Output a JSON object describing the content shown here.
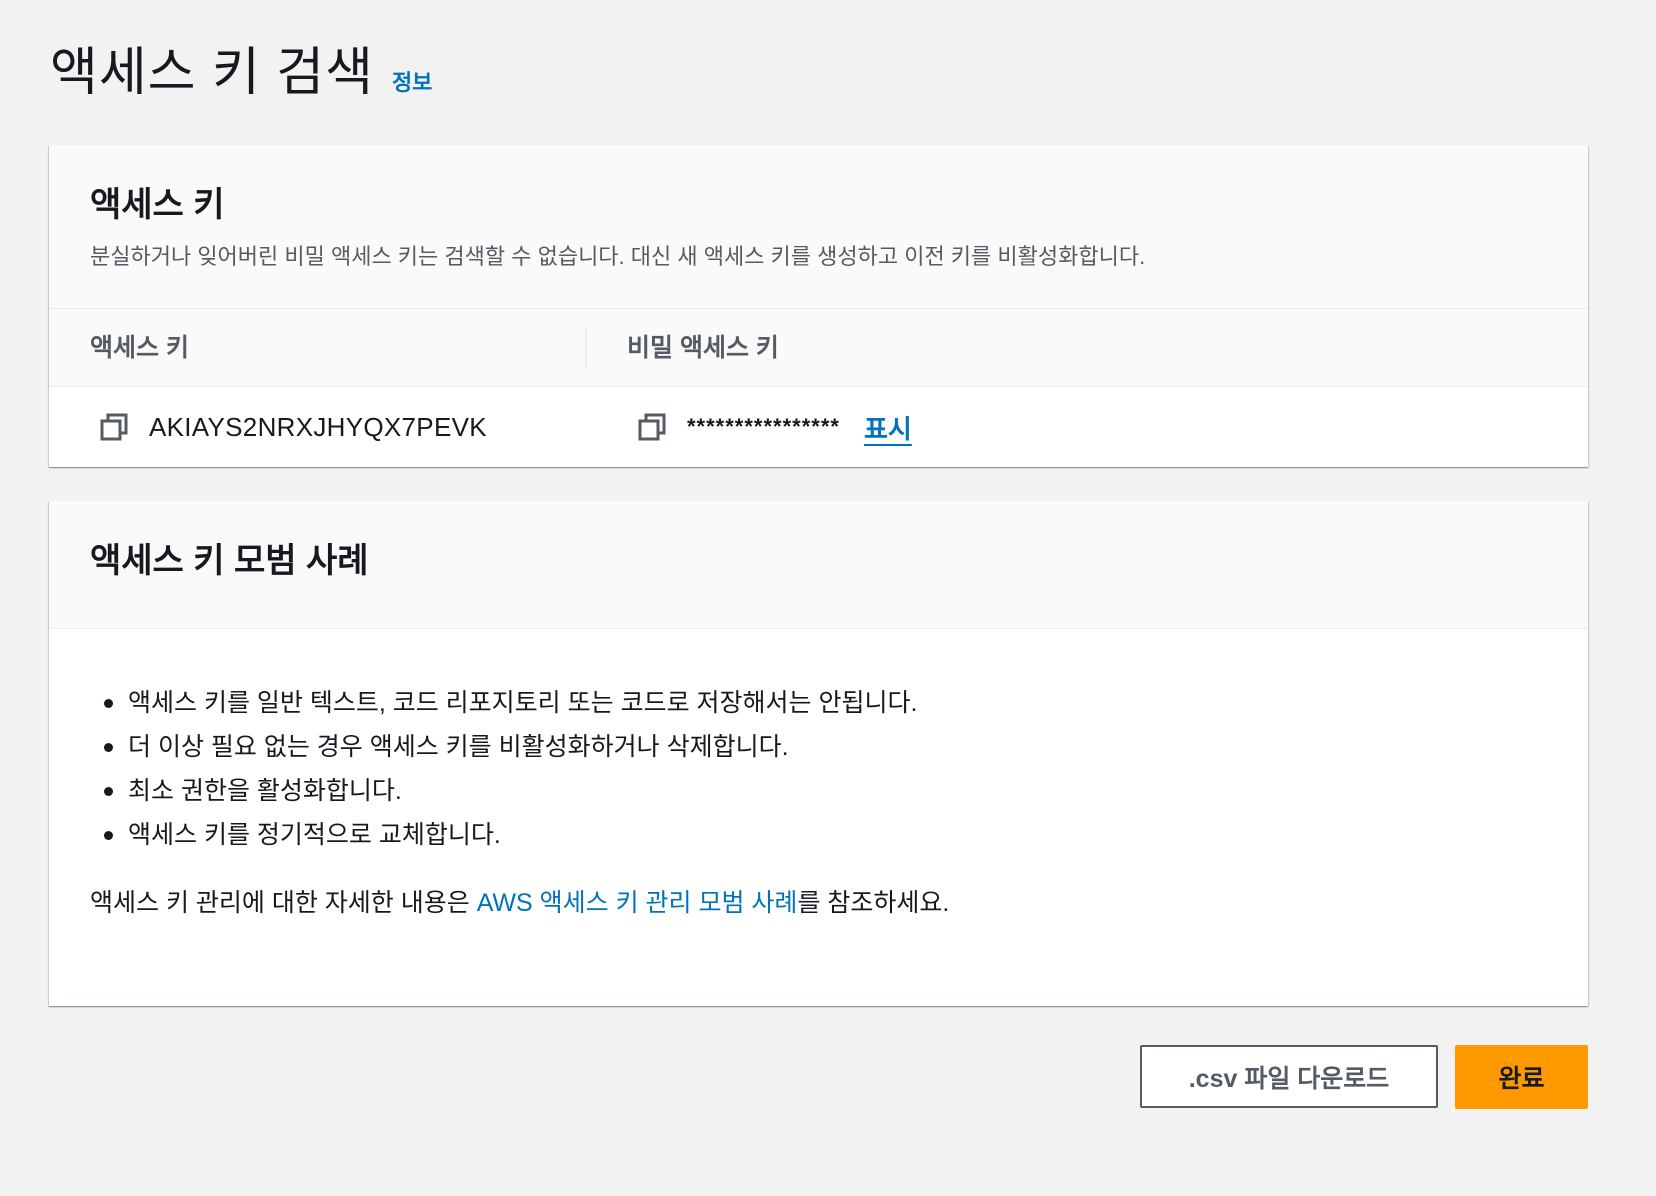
{
  "page": {
    "title": "액세스 키 검색",
    "info_link": "정보"
  },
  "access_key_panel": {
    "title": "액세스 키",
    "description": "분실하거나 잊어버린 비밀 액세스 키는 검색할 수 없습니다. 대신 새 액세스 키를 생성하고 이전 키를 비활성화합니다.",
    "columns": [
      "액세스 키",
      "비밀 액세스 키"
    ],
    "access_key_id": "AKIAYS2NRXJHYQX7PEVK",
    "secret_key_masked": "****************",
    "show_label": "표시",
    "icons": [
      "copy-icon",
      "copy-icon"
    ]
  },
  "best_practices_panel": {
    "title": "액세스 키 모범 사례",
    "items": [
      "액세스 키를 일반 텍스트, 코드 리포지토리 또는 코드로 저장해서는 안됩니다.",
      "더 이상 필요 없는 경우 액세스 키를 비활성화하거나 삭제합니다.",
      "최소 권한을 활성화합니다.",
      "액세스 키를 정기적으로 교체합니다."
    ],
    "reference_prefix": "액세스 키 관리에 대한 자세한 내용은 ",
    "reference_link": "AWS 액세스 키 관리 모범 사례",
    "reference_suffix": "를 참조하세요."
  },
  "actions": {
    "download_csv": ".csv 파일 다운로드",
    "done": "완료"
  },
  "colors": {
    "link": "#0073bb",
    "primary_button": "#ff9900",
    "background": "#f2f2f2"
  }
}
